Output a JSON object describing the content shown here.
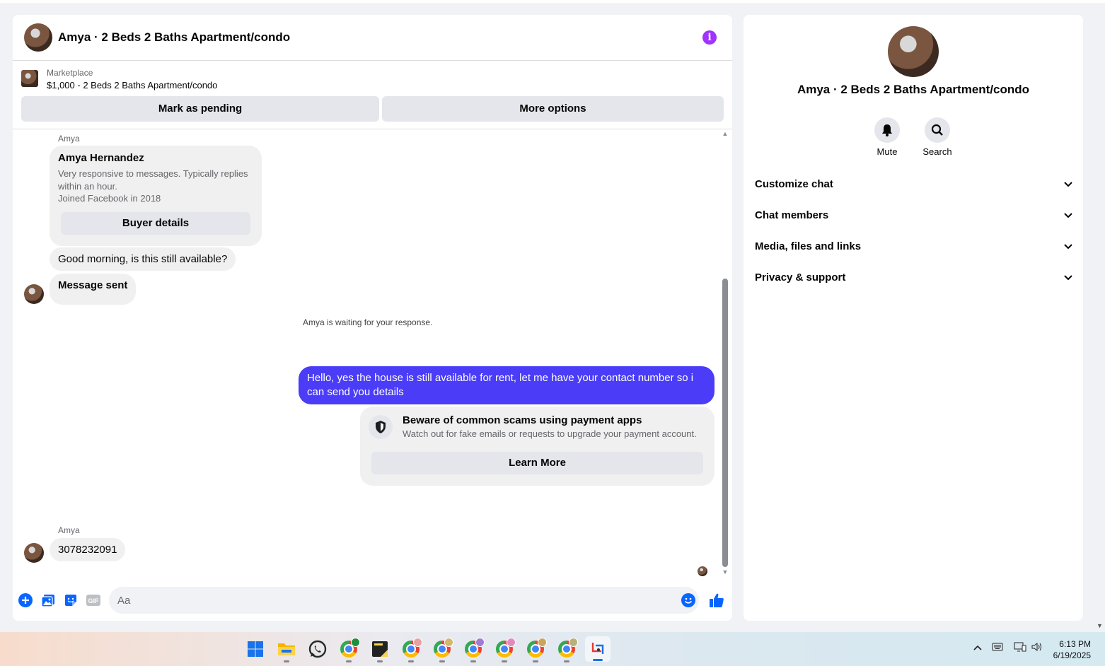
{
  "chat": {
    "title": "Amya · 2 Beds 2 Baths Apartment/condo",
    "marketplace_label": "Marketplace",
    "listing": "$1,000 - 2 Beds 2 Baths Apartment/condo",
    "mark_pending": "Mark as pending",
    "more_options": "More options"
  },
  "messages": {
    "sender1": "Amya",
    "profile": {
      "name": "Amya Hernandez",
      "description": "Very responsive to messages. Typically replies within an hour.",
      "joined": "Joined Facebook in 2018",
      "button": "Buyer details"
    },
    "incoming1": "Good morning, is this still available?",
    "incoming2": "Message sent",
    "waiting": "Amya is waiting for your response.",
    "outgoing": "Hello, yes the house is still available for rent, let me have your contact number so i can send you  details",
    "scam": {
      "title": "Beware of common scams using payment apps",
      "description": "Watch out for fake emails or requests to upgrade your payment account.",
      "button": "Learn More"
    },
    "sender2": "Amya",
    "incoming3": "3078232091"
  },
  "composer": {
    "placeholder": "Aa",
    "gif_label": "GIF"
  },
  "details_panel": {
    "title": "Amya · 2 Beds 2 Baths Apartment/condo",
    "mute": "Mute",
    "search": "Search",
    "sections": [
      "Customize chat",
      "Chat members",
      "Media, files and links",
      "Privacy & support"
    ]
  },
  "taskbar": {
    "time": "6:13 PM",
    "date": "6/19/2025",
    "icons": [
      "windows-start",
      "file-explorer",
      "whatsapp",
      "chrome-profile-m",
      "sticky-notes",
      "chrome-profile-1",
      "chrome-profile-2",
      "chrome-profile-3",
      "chrome-profile-4",
      "chrome-profile-5",
      "chrome-profile-6",
      "snipping-tool"
    ]
  },
  "colors": {
    "accent": "#0866ff",
    "outgoing_bubble": "#4a3cf7",
    "info_icon": "#a033ff"
  }
}
